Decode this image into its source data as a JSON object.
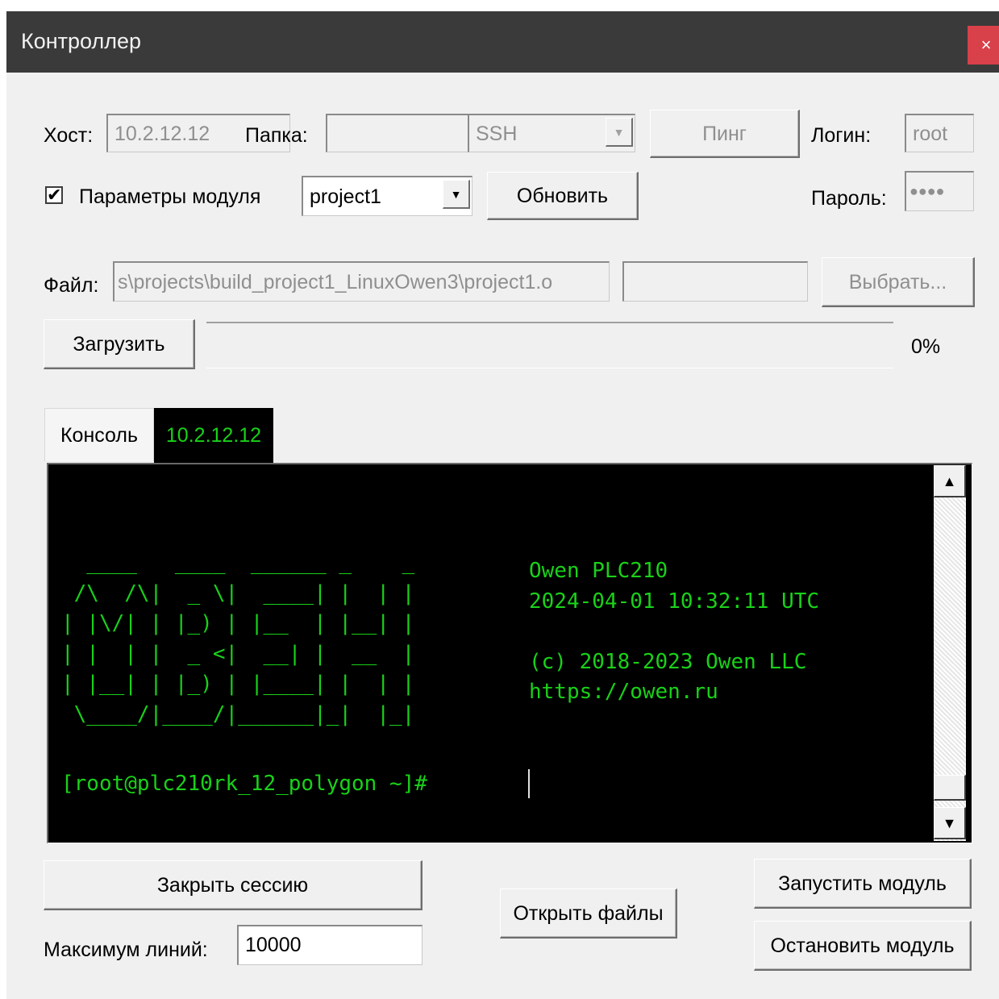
{
  "window": {
    "title": "Контроллер",
    "close_glyph": "×"
  },
  "connection": {
    "host_label": "Хост:",
    "host_value": "10.2.12.12",
    "folder_label": "Папка:",
    "folder_value": "",
    "protocol_value": "SSH",
    "ping_label": "Пинг",
    "login_label": "Логин:",
    "login_value": "root",
    "password_label": "Пароль:",
    "password_value": "●●●●"
  },
  "module": {
    "params_checkbox_label": "Параметры модуля",
    "params_checked": true,
    "check_glyph": "✔",
    "project_value": "project1",
    "refresh_label": "Обновить"
  },
  "file": {
    "label": "Файл:",
    "path_value": "s\\projects\\build_project1_LinuxOwen3\\project1.o",
    "extra_value": "",
    "choose_label": "Выбрать...",
    "upload_label": "Загрузить",
    "progress_text": "0%",
    "progress_fraction": 0
  },
  "tabs": [
    {
      "label": "Консоль",
      "active": false
    },
    {
      "label": "10.2.12.12",
      "active": true
    }
  ],
  "console": {
    "logo_lines": [
      "  ____   ____  ______ _    _",
      " /\\  /\\|  _ \\|  ____| |  | |",
      "| |\\/| | |_) | |__  | |__| |",
      "| |  | |  _ <|  __| |  __  |",
      "| |__| | |_) | |____| |  | |",
      " \\____/|____/|______|_|  |_|"
    ],
    "info_lines": [
      "Owen PLC210",
      "2024-04-01 10:32:11 UTC",
      "",
      "(c) 2018-2023 Owen LLC",
      "https://owen.ru"
    ],
    "prompt": "[root@plc210rk_12_polygon ~]#",
    "text_color": "#19d119"
  },
  "footer": {
    "close_session_label": "Закрыть сессию",
    "open_files_label": "Открыть файлы",
    "start_module_label": "Запустить модуль",
    "stop_module_label": "Остановить модуль",
    "max_lines_label": "Максимум линий:",
    "max_lines_value": "10000"
  },
  "colors": {
    "titlebar": "#3a3a3a",
    "close": "#d9414a",
    "console_bg": "#000000",
    "console_fg": "#19d119"
  }
}
